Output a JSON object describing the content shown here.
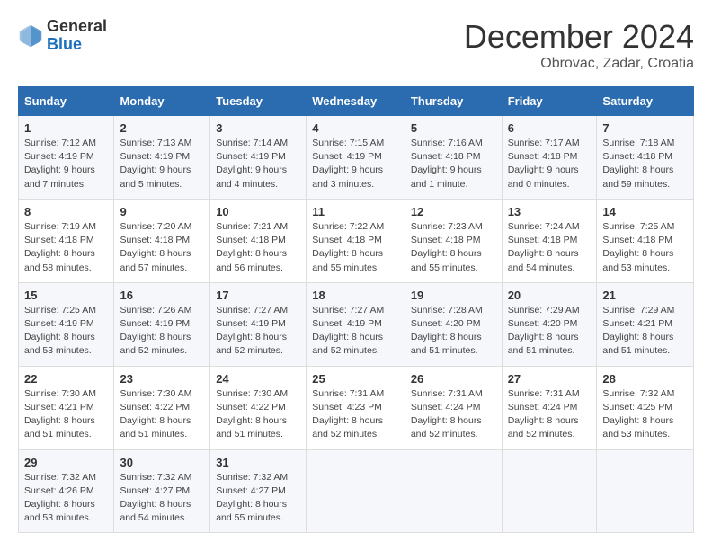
{
  "header": {
    "logo": {
      "line1": "General",
      "line2": "Blue"
    },
    "title": "December 2024",
    "location": "Obrovac, Zadar, Croatia"
  },
  "weekdays": [
    "Sunday",
    "Monday",
    "Tuesday",
    "Wednesday",
    "Thursday",
    "Friday",
    "Saturday"
  ],
  "weeks": [
    [
      {
        "day": "1",
        "sunrise": "Sunrise: 7:12 AM",
        "sunset": "Sunset: 4:19 PM",
        "daylight": "Daylight: 9 hours and 7 minutes."
      },
      {
        "day": "2",
        "sunrise": "Sunrise: 7:13 AM",
        "sunset": "Sunset: 4:19 PM",
        "daylight": "Daylight: 9 hours and 5 minutes."
      },
      {
        "day": "3",
        "sunrise": "Sunrise: 7:14 AM",
        "sunset": "Sunset: 4:19 PM",
        "daylight": "Daylight: 9 hours and 4 minutes."
      },
      {
        "day": "4",
        "sunrise": "Sunrise: 7:15 AM",
        "sunset": "Sunset: 4:19 PM",
        "daylight": "Daylight: 9 hours and 3 minutes."
      },
      {
        "day": "5",
        "sunrise": "Sunrise: 7:16 AM",
        "sunset": "Sunset: 4:18 PM",
        "daylight": "Daylight: 9 hours and 1 minute."
      },
      {
        "day": "6",
        "sunrise": "Sunrise: 7:17 AM",
        "sunset": "Sunset: 4:18 PM",
        "daylight": "Daylight: 9 hours and 0 minutes."
      },
      {
        "day": "7",
        "sunrise": "Sunrise: 7:18 AM",
        "sunset": "Sunset: 4:18 PM",
        "daylight": "Daylight: 8 hours and 59 minutes."
      }
    ],
    [
      {
        "day": "8",
        "sunrise": "Sunrise: 7:19 AM",
        "sunset": "Sunset: 4:18 PM",
        "daylight": "Daylight: 8 hours and 58 minutes."
      },
      {
        "day": "9",
        "sunrise": "Sunrise: 7:20 AM",
        "sunset": "Sunset: 4:18 PM",
        "daylight": "Daylight: 8 hours and 57 minutes."
      },
      {
        "day": "10",
        "sunrise": "Sunrise: 7:21 AM",
        "sunset": "Sunset: 4:18 PM",
        "daylight": "Daylight: 8 hours and 56 minutes."
      },
      {
        "day": "11",
        "sunrise": "Sunrise: 7:22 AM",
        "sunset": "Sunset: 4:18 PM",
        "daylight": "Daylight: 8 hours and 55 minutes."
      },
      {
        "day": "12",
        "sunrise": "Sunrise: 7:23 AM",
        "sunset": "Sunset: 4:18 PM",
        "daylight": "Daylight: 8 hours and 55 minutes."
      },
      {
        "day": "13",
        "sunrise": "Sunrise: 7:24 AM",
        "sunset": "Sunset: 4:18 PM",
        "daylight": "Daylight: 8 hours and 54 minutes."
      },
      {
        "day": "14",
        "sunrise": "Sunrise: 7:25 AM",
        "sunset": "Sunset: 4:18 PM",
        "daylight": "Daylight: 8 hours and 53 minutes."
      }
    ],
    [
      {
        "day": "15",
        "sunrise": "Sunrise: 7:25 AM",
        "sunset": "Sunset: 4:19 PM",
        "daylight": "Daylight: 8 hours and 53 minutes."
      },
      {
        "day": "16",
        "sunrise": "Sunrise: 7:26 AM",
        "sunset": "Sunset: 4:19 PM",
        "daylight": "Daylight: 8 hours and 52 minutes."
      },
      {
        "day": "17",
        "sunrise": "Sunrise: 7:27 AM",
        "sunset": "Sunset: 4:19 PM",
        "daylight": "Daylight: 8 hours and 52 minutes."
      },
      {
        "day": "18",
        "sunrise": "Sunrise: 7:27 AM",
        "sunset": "Sunset: 4:19 PM",
        "daylight": "Daylight: 8 hours and 52 minutes."
      },
      {
        "day": "19",
        "sunrise": "Sunrise: 7:28 AM",
        "sunset": "Sunset: 4:20 PM",
        "daylight": "Daylight: 8 hours and 51 minutes."
      },
      {
        "day": "20",
        "sunrise": "Sunrise: 7:29 AM",
        "sunset": "Sunset: 4:20 PM",
        "daylight": "Daylight: 8 hours and 51 minutes."
      },
      {
        "day": "21",
        "sunrise": "Sunrise: 7:29 AM",
        "sunset": "Sunset: 4:21 PM",
        "daylight": "Daylight: 8 hours and 51 minutes."
      }
    ],
    [
      {
        "day": "22",
        "sunrise": "Sunrise: 7:30 AM",
        "sunset": "Sunset: 4:21 PM",
        "daylight": "Daylight: 8 hours and 51 minutes."
      },
      {
        "day": "23",
        "sunrise": "Sunrise: 7:30 AM",
        "sunset": "Sunset: 4:22 PM",
        "daylight": "Daylight: 8 hours and 51 minutes."
      },
      {
        "day": "24",
        "sunrise": "Sunrise: 7:30 AM",
        "sunset": "Sunset: 4:22 PM",
        "daylight": "Daylight: 8 hours and 51 minutes."
      },
      {
        "day": "25",
        "sunrise": "Sunrise: 7:31 AM",
        "sunset": "Sunset: 4:23 PM",
        "daylight": "Daylight: 8 hours and 52 minutes."
      },
      {
        "day": "26",
        "sunrise": "Sunrise: 7:31 AM",
        "sunset": "Sunset: 4:24 PM",
        "daylight": "Daylight: 8 hours and 52 minutes."
      },
      {
        "day": "27",
        "sunrise": "Sunrise: 7:31 AM",
        "sunset": "Sunset: 4:24 PM",
        "daylight": "Daylight: 8 hours and 52 minutes."
      },
      {
        "day": "28",
        "sunrise": "Sunrise: 7:32 AM",
        "sunset": "Sunset: 4:25 PM",
        "daylight": "Daylight: 8 hours and 53 minutes."
      }
    ],
    [
      {
        "day": "29",
        "sunrise": "Sunrise: 7:32 AM",
        "sunset": "Sunset: 4:26 PM",
        "daylight": "Daylight: 8 hours and 53 minutes."
      },
      {
        "day": "30",
        "sunrise": "Sunrise: 7:32 AM",
        "sunset": "Sunset: 4:27 PM",
        "daylight": "Daylight: 8 hours and 54 minutes."
      },
      {
        "day": "31",
        "sunrise": "Sunrise: 7:32 AM",
        "sunset": "Sunset: 4:27 PM",
        "daylight": "Daylight: 8 hours and 55 minutes."
      },
      null,
      null,
      null,
      null
    ]
  ]
}
